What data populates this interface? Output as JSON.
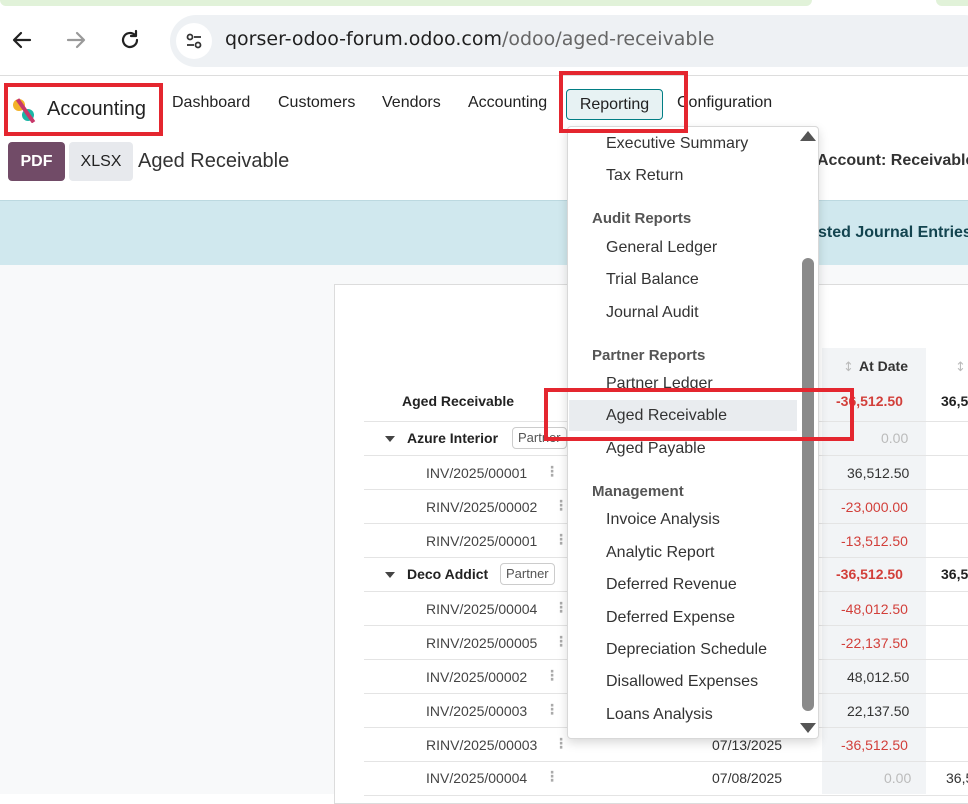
{
  "browser": {
    "url_host": "qorser-odoo-forum.odoo.com",
    "url_path": "/odoo/aged-receivable"
  },
  "navbar": {
    "app_name": "Accounting",
    "menu": [
      "Dashboard",
      "Customers",
      "Vendors",
      "Accounting",
      "Reporting",
      "Configuration"
    ]
  },
  "control_panel": {
    "pdf_label": "PDF",
    "xlsx_label": "XLSX",
    "title": "Aged Receivable",
    "account_filter": "Account: Receivable"
  },
  "banner": {
    "text": "sted Journal Entries"
  },
  "table": {
    "col_at_date": "At Date",
    "col_next_partial": "36,5",
    "root": {
      "label": "Aged Receivable",
      "at_date": "-36,512.50",
      "next": "36,5"
    },
    "groups": [
      {
        "name": "Azure Interior",
        "badge": "Partner",
        "at_date": "0.00",
        "rows": [
          {
            "ref": "INV/2025/00001",
            "at_date": "36,512.50",
            "neg": false
          },
          {
            "ref": "RINV/2025/00002",
            "at_date": "-23,000.00",
            "neg": true
          },
          {
            "ref": "RINV/2025/00001",
            "at_date": "-13,512.50",
            "neg": true
          }
        ]
      },
      {
        "name": "Deco Addict",
        "badge": "Partner",
        "at_date": "-36,512.50",
        "next": "36,5",
        "rows": [
          {
            "ref": "RINV/2025/00004",
            "at_date": "-48,012.50",
            "neg": true
          },
          {
            "ref": "RINV/2025/00005",
            "at_date": "-22,137.50",
            "neg": true
          },
          {
            "ref": "INV/2025/00002",
            "at_date": "48,012.50",
            "neg": false
          },
          {
            "ref": "INV/2025/00003",
            "at_date": "22,137.50",
            "neg": false
          },
          {
            "ref": "RINV/2025/00003",
            "date": "07/13/2025",
            "at_date": "-36,512.50",
            "neg": true
          },
          {
            "ref": "INV/2025/00004",
            "date": "07/08/2025",
            "at_date": "0.00",
            "next": "36,5",
            "neg": false
          }
        ]
      }
    ]
  },
  "reporting_menu": {
    "top_items": [
      "Executive Summary",
      "Tax Return"
    ],
    "sections": [
      {
        "header": "Audit Reports",
        "items": [
          "General Ledger",
          "Trial Balance",
          "Journal Audit"
        ]
      },
      {
        "header": "Partner Reports",
        "items": [
          "Partner Ledger",
          "Aged Receivable",
          "Aged Payable"
        ]
      },
      {
        "header": "Management",
        "items": [
          "Invoice Analysis",
          "Analytic Report",
          "Deferred Revenue",
          "Deferred Expense",
          "Depreciation Schedule",
          "Disallowed Expenses",
          "Loans Analysis"
        ]
      }
    ],
    "active_item": "Aged Receivable"
  },
  "colors": {
    "brand": "#714b67",
    "accent": "#017e84",
    "negative": "#d23f3a",
    "highlight_box": "#e4262f",
    "banner": "#d0e8ee"
  },
  "icons": [
    "back-arrow-icon",
    "forward-arrow-icon",
    "reload-icon",
    "site-settings-icon",
    "accounting-app-icon",
    "caret-down-icon",
    "drag-handle-icon",
    "sort-icon",
    "scroll-up-icon",
    "scroll-down-icon"
  ]
}
